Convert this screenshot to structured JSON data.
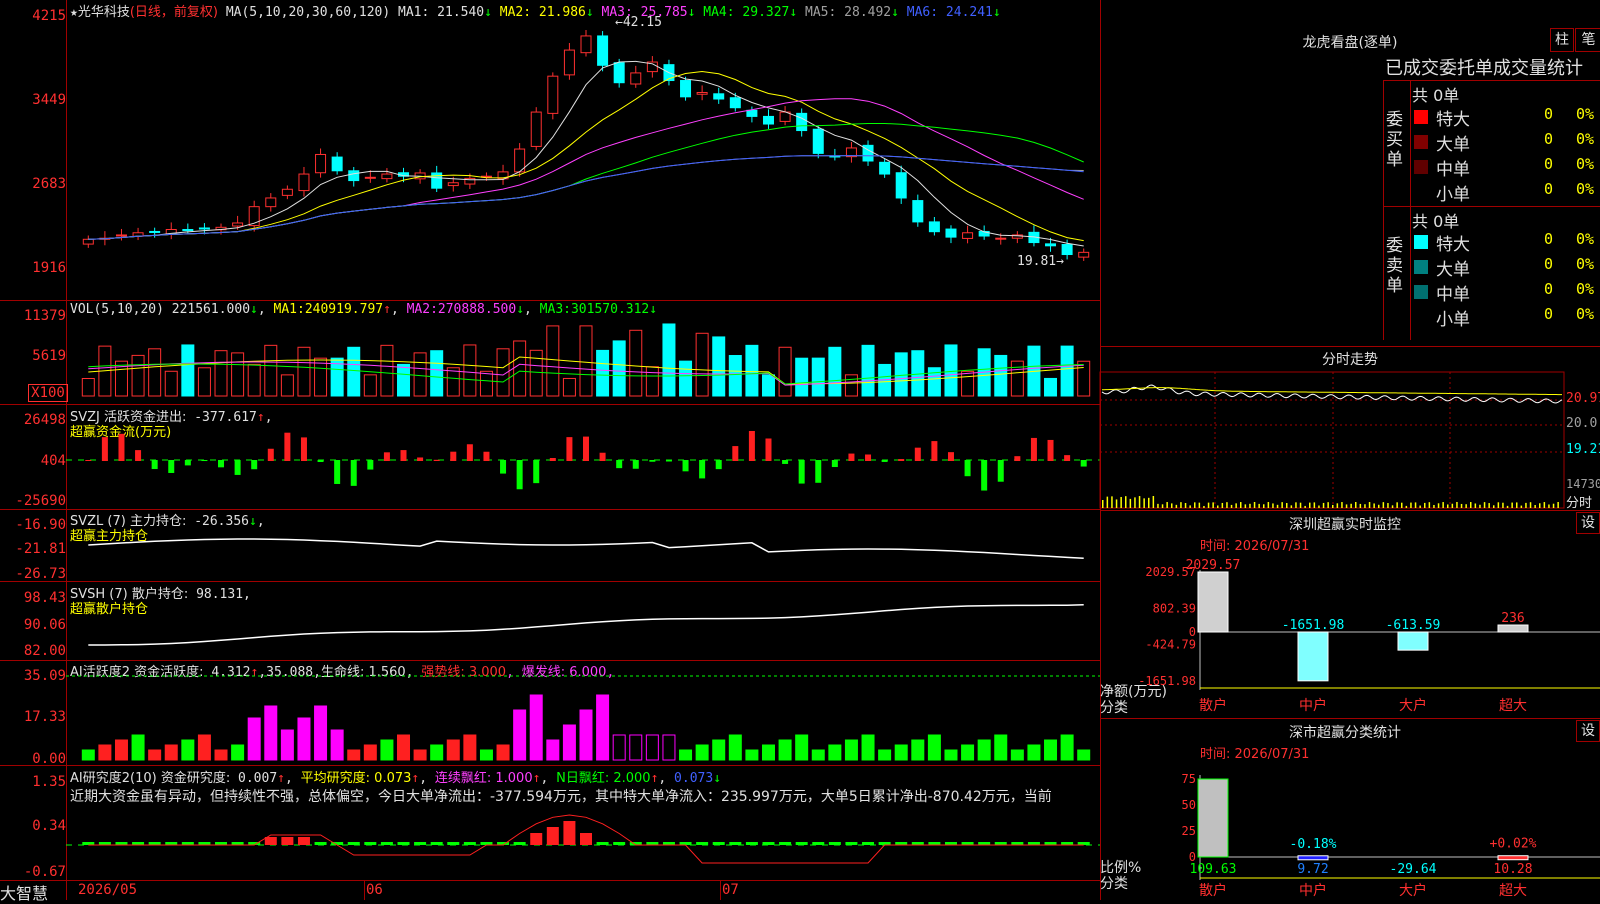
{
  "main": {
    "stock_name": "光华科技",
    "period": "(日线，前复权)",
    "ma_header": "MA(5,10,20,30,60,120)",
    "ma_items": [
      {
        "label": "MA1:",
        "value": "21.540",
        "dir": "↓",
        "color": "#e0e0e0"
      },
      {
        "label": "MA2:",
        "value": "21.986",
        "dir": "↓",
        "color": "#ffff00"
      },
      {
        "label": "MA3:",
        "value": "25.785",
        "dir": "↓",
        "color": "#ff40ff"
      },
      {
        "label": "MA4:",
        "value": "29.327",
        "dir": "↓",
        "color": "#00ff00"
      },
      {
        "label": "MA5:",
        "value": "28.492",
        "dir": "↓",
        "color": "#a0a0a0"
      },
      {
        "label": "MA6:",
        "value": "24.241",
        "dir": "↓",
        "color": "#4060ff"
      }
    ],
    "y_ticks": [
      "4215",
      "3449",
      "2683",
      "1916"
    ],
    "high_label": "42.15",
    "low_label": "19.81"
  },
  "vol": {
    "header": "VOL(5,10,20)",
    "value": "221561.000",
    "dir": "↓",
    "ma1": "240919.797",
    "ma1dir": "↑",
    "ma2": "270888.500",
    "ma2dir": "↓",
    "ma3": "301570.312",
    "ma3dir": "↓",
    "y_ticks": [
      "11379",
      "5619",
      "X100"
    ]
  },
  "svzj": {
    "line1": "SVZJ  活跃资金进出:",
    "value": "-377.617",
    "dir": "↑",
    "line2": "超赢资金流(万元)",
    "y_ticks": [
      "26498",
      "404",
      "-25690"
    ]
  },
  "svzl": {
    "line1": "SVZL (7) 主力持仓:",
    "value": "-26.356",
    "dir": "↓",
    "line2": "超赢主力持仓",
    "y_ticks": [
      "-16.90",
      "-21.81",
      "-26.73"
    ]
  },
  "svsh": {
    "line1": "SVSH (7) 散户持仓:",
    "value": "98.131",
    "line2": "超赢散户持仓",
    "y_ticks": [
      "98.43",
      "90.06",
      "82.00"
    ]
  },
  "ai1": {
    "line1": "AI活跃度2 资金活跃度:",
    "value": "4.312",
    "dir": "↑",
    "v2": "35.088",
    "life": "生命线: 1.560",
    "strong": "强势线: 3.000",
    "burst": "爆发线: 6.000",
    "y_ticks": [
      "35.09",
      "17.33",
      "0.00"
    ]
  },
  "ai2": {
    "line1": "AI研究度2(10) 资金研究度:",
    "value": "0.007",
    "dir": "↑",
    "avg": "平均研究度: 0.073",
    "avgdir": "↑",
    "cont": "连续飘红: 1.000",
    "contdir": "↑",
    "nday": "N日飘红: 2.000",
    "ndaydir": "↑",
    "last": "0.073",
    "lastdir": "↓",
    "comment": "近期大资金虽有异动，但持续性不强，总体偏空，今日大单净流出：-377.594万元，其中特大单净流入：235.997万元，大单5日累计净出-870.42万元，当前",
    "y_ticks": [
      "1.35",
      "0.34",
      "-0.67"
    ]
  },
  "bottom": {
    "brand": "大智慧",
    "dates": [
      "2026/05",
      "06",
      "07"
    ]
  },
  "longhu": {
    "title": "龙虎看盘(逐单)",
    "btn1": "柱",
    "btn2": "笔",
    "tabs": "已成交委托单成交量统计",
    "buy_label": "委买单",
    "sell_label": "委卖单",
    "buy_total": "共 0单",
    "sell_total": "共 0单",
    "buy_rows": [
      {
        "name": "特大",
        "val": "0",
        "pct": "0%",
        "color": "#ff0000"
      },
      {
        "name": "大单",
        "val": "0",
        "pct": "0%",
        "color": "#800000"
      },
      {
        "name": "中单",
        "val": "0",
        "pct": "0%",
        "color": "#600000"
      },
      {
        "name": "小单",
        "val": "0",
        "pct": "0%",
        "color": ""
      }
    ],
    "sell_rows": [
      {
        "name": "特大",
        "val": "0",
        "pct": "0%",
        "color": "#00ffff"
      },
      {
        "name": "大单",
        "val": "0",
        "pct": "0%",
        "color": "#008080"
      },
      {
        "name": "中单",
        "val": "0",
        "pct": "0%",
        "color": "#007070"
      },
      {
        "name": "小单",
        "val": "0",
        "pct": "0%",
        "color": ""
      }
    ]
  },
  "intraday": {
    "title": "分时走势",
    "y_ticks": [
      "20.97",
      "20.0",
      "19.21",
      "14730"
    ],
    "unit": "分时"
  },
  "monitor": {
    "title": "深圳超赢实时监控",
    "btn": "设",
    "time": "时间: 2026/07/31",
    "y_ticks": [
      "2029.57",
      "802.39",
      "0",
      "-424.79",
      "-1651.98"
    ],
    "bars": [
      {
        "cat": "散户",
        "value": 2029.57,
        "label": "2029.57"
      },
      {
        "cat": "中户",
        "value": -1651.98,
        "label": "-1651.98"
      },
      {
        "cat": "大户",
        "value": -613.59,
        "label": "-613.59"
      },
      {
        "cat": "超大",
        "value": 236,
        "label": "236"
      }
    ],
    "ylabel": "净额(万元)",
    "xlabel": "分类"
  },
  "classify": {
    "title": "深市超赢分类统计",
    "btn": "设",
    "time": "时间: 2026/07/31",
    "y_ticks": [
      "75",
      "50",
      "25",
      "0"
    ],
    "bars": [
      {
        "cat": "散户",
        "value": 109.63,
        "label": "109.63",
        "top": ""
      },
      {
        "cat": "中户",
        "value": 9.72,
        "label": "9.72",
        "top": "-0.18%"
      },
      {
        "cat": "大户",
        "value": -29.64,
        "label": "-29.64",
        "top": ""
      },
      {
        "cat": "超大",
        "value": 10.28,
        "label": "10.28",
        "top": "+0.02%"
      }
    ],
    "ylabel": "比例%",
    "xlabel": "分类"
  },
  "chart_data": {
    "type": "candlestick",
    "x": [
      "2026/05",
      "06",
      "07"
    ],
    "close_series_approx": [
      21.8,
      21.9,
      22.2,
      22.4,
      22.5,
      22.7,
      22.6,
      22.8,
      22.9,
      23.3,
      24.8,
      25.6,
      26.4,
      27.8,
      29.6,
      28.1,
      27.2,
      27.5,
      27.8,
      27.6,
      27.9,
      26.5,
      27.0,
      27.4,
      27.6,
      28.0,
      30.1,
      33.5,
      36.8,
      39.2,
      40.5,
      37.8,
      36.2,
      37.1,
      38.1,
      36.4,
      34.9,
      35.3,
      34.7,
      33.9,
      33.1,
      32.4,
      33.5,
      31.8,
      29.7,
      29.4,
      30.2,
      29.0,
      27.8,
      25.6,
      23.4,
      22.5,
      22.0,
      22.4,
      22.1,
      21.9,
      22.2,
      21.5,
      21.2,
      20.4,
      20.6
    ],
    "volume_ma": {
      "ma1": 240919.797,
      "ma2": 270888.5,
      "ma3": 301570.312
    }
  }
}
